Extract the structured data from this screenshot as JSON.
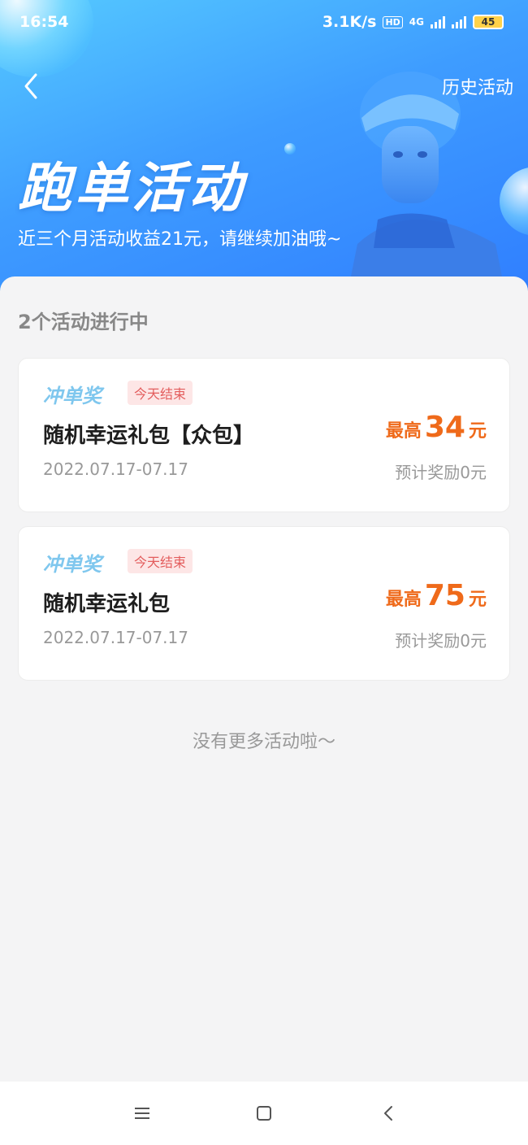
{
  "status_bar": {
    "time": "16:54",
    "net_speed": "3.1K/s",
    "hd_label": "HD",
    "network": "4G",
    "battery": "45"
  },
  "header": {
    "history_label": "历史活动",
    "title": "跑单活动",
    "subtitle": "近三个月活动收益21元，请继续加油哦~"
  },
  "main": {
    "section_title": "2个活动进行中",
    "activities": [
      {
        "type_tag": "冲单奖",
        "end_tag": "今天结束",
        "title": "随机幸运礼包【众包】",
        "date_range": "2022.07.17-07.17",
        "max_label": "最高",
        "max_value": "34",
        "max_unit": "元",
        "estimate": "预计奖励0元"
      },
      {
        "type_tag": "冲单奖",
        "end_tag": "今天结束",
        "title": "随机幸运礼包",
        "date_range": "2022.07.17-07.17",
        "max_label": "最高",
        "max_value": "75",
        "max_unit": "元",
        "estimate": "预计奖励0元"
      }
    ],
    "no_more": "没有更多活动啦～"
  },
  "colors": {
    "banner_start": "#55c9ff",
    "banner_end": "#2f7dff",
    "accent_orange": "#ef6a1a",
    "tag_red": "#e35d5d",
    "tag_type_blue": "#7fc7ee"
  },
  "icons": {
    "back": "chevron-left-icon",
    "nav_menu": "menu-icon",
    "nav_home": "home-square-icon",
    "nav_back": "back-arrow-icon"
  }
}
